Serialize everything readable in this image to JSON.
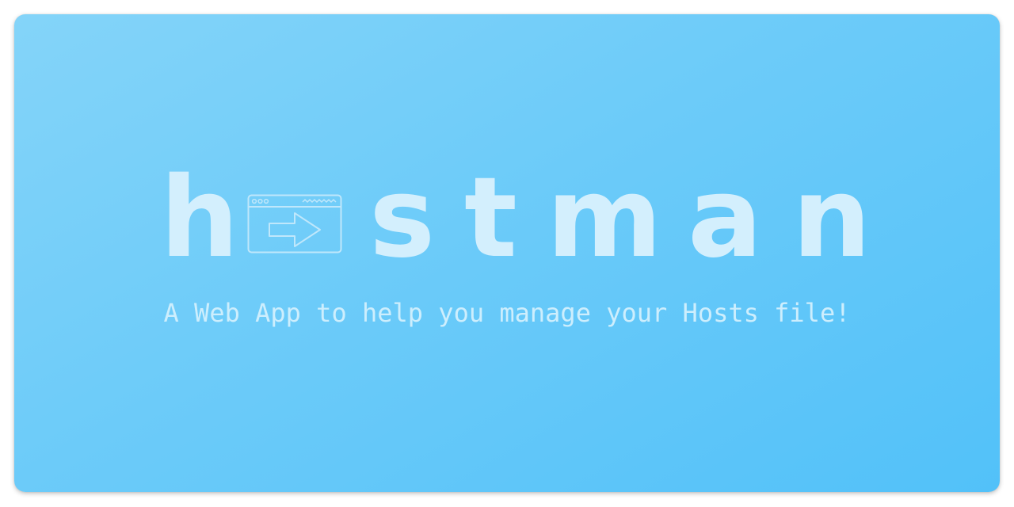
{
  "logo": {
    "letters": [
      "h",
      "s",
      "t",
      "m",
      "a",
      "n"
    ],
    "icon": "browser-window-arrow-icon"
  },
  "tagline": "A Web App to help you manage your Hosts file!",
  "colors": {
    "background_start": "#84d4f9",
    "background_end": "#52c1f9",
    "logo_text": "#d3effd",
    "tagline_text": "#cdeefd"
  }
}
